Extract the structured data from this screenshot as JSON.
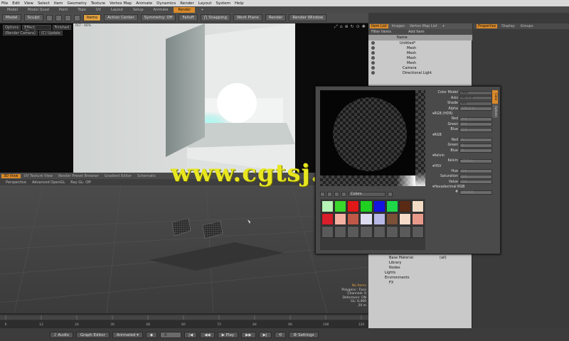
{
  "menubar": [
    "File",
    "Edit",
    "View",
    "Select",
    "Item",
    "Geometry",
    "Texture",
    "Vertex Map",
    "Animate",
    "Dynamics",
    "Render",
    "Layout",
    "System",
    "Help"
  ],
  "layout_tabs": [
    {
      "label": "Model",
      "active": false
    },
    {
      "label": "Model Quad",
      "active": false
    },
    {
      "label": "Paint",
      "active": false
    },
    {
      "label": "Topo",
      "active": false
    },
    {
      "label": "UV",
      "active": false
    },
    {
      "label": "Layout",
      "active": false
    },
    {
      "label": "Setup",
      "active": false
    },
    {
      "label": "Animate",
      "active": false
    },
    {
      "label": "Render",
      "active": true
    },
    {
      "label": "+",
      "active": false
    }
  ],
  "toolbar": {
    "mode": "Model",
    "sculpt": "Sculpt",
    "items": "Items",
    "action_center": "Action Center",
    "symmetry": "Symmetry: Off",
    "falloff": "Falloff",
    "snapping": "Snapping",
    "work_plane": "Work Plane",
    "render": "Render",
    "render_window": "Render Window"
  },
  "render_view": {
    "opts_row1": [
      "Options",
      "Effect: (Shadi...",
      "Finished"
    ],
    "opts_row2": [
      "(Render Camera)",
      "(C) Update"
    ],
    "label": "RLT - 66%"
  },
  "watermark": "www.cgtsj.com",
  "view3d_tabs": [
    {
      "label": "3D View",
      "active": true
    },
    {
      "label": "UV Texture View",
      "active": false
    },
    {
      "label": "Render Preset Browser",
      "active": false
    },
    {
      "label": "Gradient Editor",
      "active": false
    },
    {
      "label": "Schematic",
      "active": false
    }
  ],
  "view3d_bar": [
    "Perspective",
    "Advanced OpenGL",
    "Ray GL: Off"
  ],
  "view_info": [
    "No Items",
    "Polygons : Face",
    "Channels: 0",
    "Deformers: ON",
    "GL: 6,460",
    "20 m"
  ],
  "timeline_ticks": [
    "0",
    "12",
    "24",
    "36",
    "48",
    "60",
    "72",
    "84",
    "96",
    "108",
    "120"
  ],
  "bottom_bar": {
    "audio": "Audio",
    "graph_editor": "Graph Editor",
    "animated": "Animated",
    "frame": "0",
    "play": "Play",
    "settings": "Settings"
  },
  "item_list": {
    "tabs": [
      {
        "label": "Item List",
        "active": true
      },
      {
        "label": "Images",
        "active": false
      },
      {
        "label": "Vertex Map List",
        "active": false
      },
      {
        "label": "+",
        "active": false
      }
    ],
    "filter": "Filter Items",
    "add_item": "Add Item",
    "col_name": "Name",
    "tree": [
      "Untitled*",
      "Mesh",
      "Mesh",
      "Mesh",
      "Mesh",
      "Camera",
      "Directional Light"
    ],
    "lower": [
      "Base Material",
      "Library",
      "Nodes",
      "Lights",
      "Environments",
      "FX"
    ],
    "lower_all": "(all)"
  },
  "prop_tabs": [
    {
      "label": "Properties",
      "active": true
    },
    {
      "label": "Display",
      "active": false
    },
    {
      "label": "Groups",
      "active": false
    }
  ],
  "picker": {
    "color_model_label": "Color Model",
    "color_model": "HSV",
    "axis_label": "Axis",
    "axis": "HS + V",
    "shade_label": "Shade",
    "shade": "0.0",
    "alpha_label": "Alpha",
    "alpha": "100.0 %",
    "rgb_hdr": "RGB (HDR)",
    "rgb": "RGB",
    "kelvin": "Kelvin",
    "hsv": "HSV",
    "hexadecimal": "Hexadecimal RGB",
    "hdr_values": [
      {
        "l": "Red",
        "v": "0.0"
      },
      {
        "l": "Green",
        "v": "0.0"
      },
      {
        "l": "Blue",
        "v": "0.0"
      }
    ],
    "rgb_values": [
      {
        "l": "Red",
        "v": "0"
      },
      {
        "l": "Green",
        "v": "0"
      },
      {
        "l": "Blue",
        "v": "0"
      }
    ],
    "kelvin_value": {
      "l": "Kelvin",
      "v": "6500.0"
    },
    "hsv_values": [
      {
        "l": "Hue",
        "v": "0.0"
      },
      {
        "l": "Saturation",
        "v": "0.0"
      },
      {
        "l": "Value",
        "v": "0.0"
      }
    ],
    "hex_value": {
      "l": "#",
      "v": "000000"
    },
    "side_tabs": [
      "Color",
      "Options"
    ],
    "palette_label": "Colors",
    "swatches": [
      "#b6f3b6",
      "#39d72b",
      "#e01818",
      "#20d020",
      "#1414e0",
      "#1fd84a",
      "#5a2a14",
      "#f2dcc6",
      "#d81e2a",
      "#f4b0a0",
      "#c05848",
      "#dcdcf0",
      "#b8b8e6",
      "#7a5038",
      "#f6dcc8",
      "#e89a8a",
      "#5a5a5a",
      "#5a5a5a",
      "#5a5a5a",
      "#5a5a5a",
      "#5a5a5a",
      "#5a5a5a",
      "#5a5a5a",
      "#5a5a5a"
    ]
  }
}
